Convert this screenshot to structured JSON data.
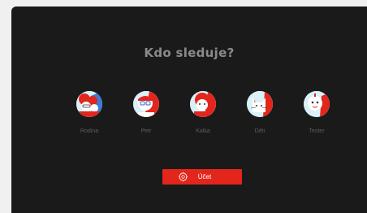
{
  "header": {
    "title": "Kdo sleduje?"
  },
  "profiles": [
    {
      "name": "Rodina",
      "icon": "family-avatar-icon"
    },
    {
      "name": "Petr",
      "icon": "glasses-boy-avatar-icon"
    },
    {
      "name": "Kalka",
      "icon": "redhair-avatar-icon"
    },
    {
      "name": "Děti",
      "icon": "cat-avatar-icon"
    },
    {
      "name": "Tester",
      "icon": "robot-avatar-icon"
    }
  ],
  "account": {
    "label": "Účet",
    "icon": "gear-icon"
  },
  "colors": {
    "background": "#1a1a1a",
    "accent": "#e2261c",
    "avatar_bg": "#d9f0f7"
  }
}
